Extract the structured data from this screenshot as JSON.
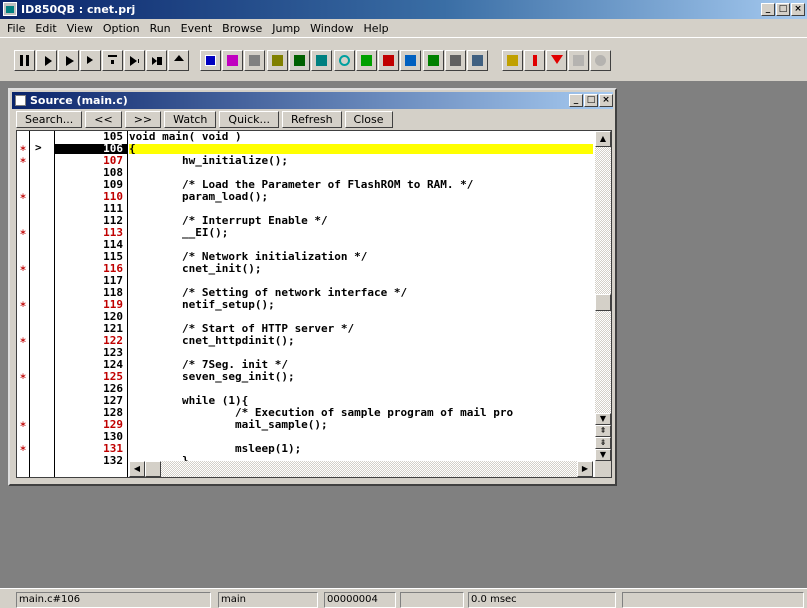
{
  "app": {
    "title": "ID850QB : cnet.prj",
    "minimize": "_",
    "maximize": "□",
    "close": "×"
  },
  "menu": [
    "File",
    "Edit",
    "View",
    "Option",
    "Run",
    "Event",
    "Browse",
    "Jump",
    "Window",
    "Help"
  ],
  "toolbar": {
    "groups": [
      [
        "pause-icon",
        "step-over-icon",
        "run-icon",
        "step-in-icon",
        "return-icon",
        "run-to-cursor-icon",
        "restart-icon",
        "eject-icon"
      ],
      [
        "watch-window-icon",
        "memory-window-icon",
        "register-window-icon"
      ],
      [
        "sfr-window-icon",
        "assemble-icon",
        "cache-icon"
      ],
      [
        "search-icon",
        "trace-icon",
        "event-icon",
        "coverage-icon"
      ],
      [
        "stack-icon",
        "breakpoint-icon",
        "timer-icon"
      ],
      [
        "console-icon",
        "event-manager-icon",
        "snap-icon",
        "disabled-icon",
        "disabled-icon"
      ]
    ]
  },
  "source_window": {
    "title": "Source (main.c)",
    "minimize": "_",
    "maximize": "□",
    "close": "×",
    "buttons": [
      "Search...",
      "<<",
      ">>",
      "Watch",
      "Quick...",
      "Refresh",
      "Close"
    ],
    "current_line": "106",
    "lines": [
      {
        "no": "105",
        "mark": false,
        "text": "void main( void )"
      },
      {
        "no": "106",
        "mark": true,
        "current": true,
        "text": "{"
      },
      {
        "no": "107",
        "mark": true,
        "text": "        hw_initialize();"
      },
      {
        "no": "108",
        "mark": false,
        "text": ""
      },
      {
        "no": "109",
        "mark": false,
        "text": "        /* Load the Parameter of FlashROM to RAM. */"
      },
      {
        "no": "110",
        "mark": true,
        "text": "        param_load();"
      },
      {
        "no": "111",
        "mark": false,
        "text": ""
      },
      {
        "no": "112",
        "mark": false,
        "text": "        /* Interrupt Enable */"
      },
      {
        "no": "113",
        "mark": true,
        "text": "        __EI();"
      },
      {
        "no": "114",
        "mark": false,
        "text": ""
      },
      {
        "no": "115",
        "mark": false,
        "text": "        /* Network initialization */"
      },
      {
        "no": "116",
        "mark": true,
        "text": "        cnet_init();"
      },
      {
        "no": "117",
        "mark": false,
        "text": ""
      },
      {
        "no": "118",
        "mark": false,
        "text": "        /* Setting of network interface */"
      },
      {
        "no": "119",
        "mark": true,
        "text": "        netif_setup();"
      },
      {
        "no": "120",
        "mark": false,
        "text": ""
      },
      {
        "no": "121",
        "mark": false,
        "text": "        /* Start of HTTP server */"
      },
      {
        "no": "122",
        "mark": true,
        "text": "        cnet_httpdinit();"
      },
      {
        "no": "123",
        "mark": false,
        "text": ""
      },
      {
        "no": "124",
        "mark": false,
        "text": "        /* 7Seg. init */"
      },
      {
        "no": "125",
        "mark": true,
        "text": "        seven_seg_init();"
      },
      {
        "no": "126",
        "mark": false,
        "text": ""
      },
      {
        "no": "127",
        "mark": false,
        "text": "        while (1){"
      },
      {
        "no": "128",
        "mark": false,
        "text": "                /* Execution of sample program of mail pro"
      },
      {
        "no": "129",
        "mark": true,
        "text": "                mail_sample();"
      },
      {
        "no": "130",
        "mark": false,
        "text": ""
      },
      {
        "no": "131",
        "mark": true,
        "text": "                msleep(1);"
      },
      {
        "no": "132",
        "mark": false,
        "text": "        }"
      }
    ]
  },
  "statusbar": {
    "location": "main.c#106",
    "function": "main",
    "address": "00000004",
    "time": "0.0 msec"
  }
}
